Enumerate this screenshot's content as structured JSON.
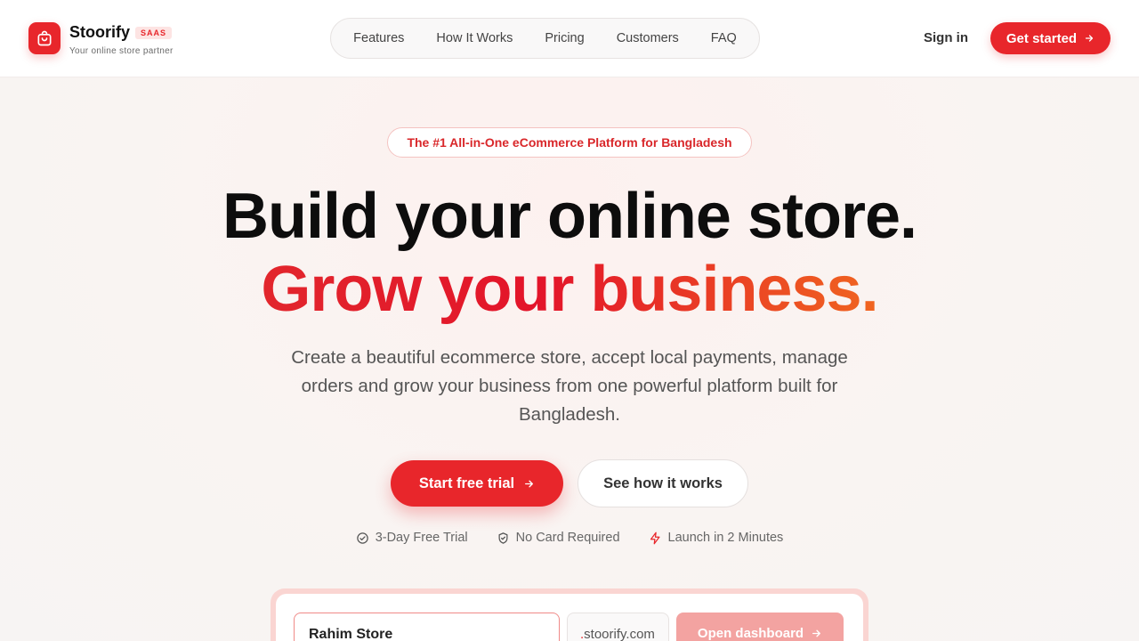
{
  "brand": {
    "name": "Stoorify",
    "badge": "SAAS",
    "tagline": "Your online store partner",
    "accent_color": "#e8262b"
  },
  "nav": {
    "items": [
      "Features",
      "How It Works",
      "Pricing",
      "Customers",
      "FAQ"
    ]
  },
  "header_actions": {
    "signin_label": "Sign in",
    "get_started_label": "Get started",
    "get_started_icon": "arrow-right-icon"
  },
  "hero": {
    "pill_text": "The #1 All-in-One eCommerce Platform for Bangladesh",
    "heading_line1": "Build your online store.",
    "heading_line2": "Grow your business.",
    "subtitle": "Create a beautiful ecommerce store, accept local payments, manage orders and grow your business from one powerful platform built for Bangladesh.",
    "cta_primary": "Start free trial",
    "cta_secondary": "See how it works",
    "features": [
      {
        "icon": "check-circle-icon",
        "label": "3-Day Free Trial"
      },
      {
        "icon": "shield-check-icon",
        "label": "No Card Required"
      },
      {
        "icon": "lightning-icon",
        "label": "Launch in 2 Minutes"
      }
    ]
  },
  "store_card": {
    "store_name_value": "Rahim Store",
    "domain_dot": ".",
    "domain_suffix": "stoorify.com",
    "open_dashboard_label": "Open dashboard"
  }
}
